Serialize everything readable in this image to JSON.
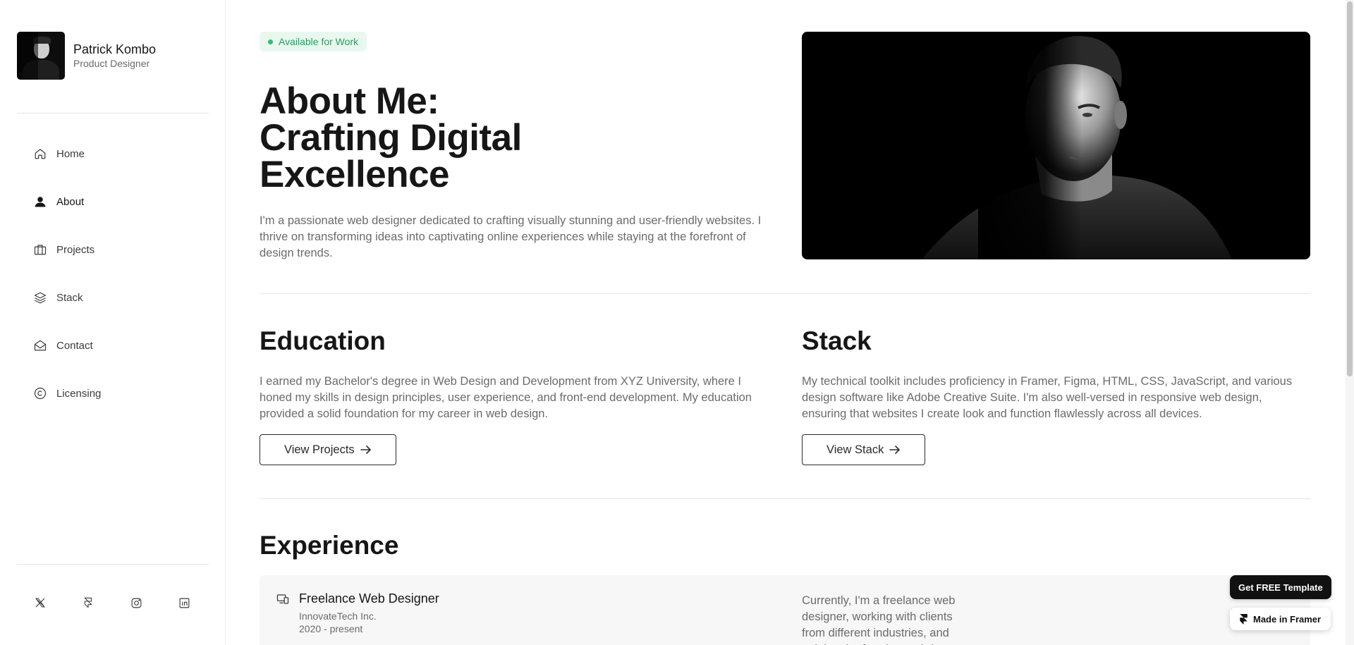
{
  "profile": {
    "name": "Patrick Kombo",
    "role": "Product Designer"
  },
  "nav": {
    "items": [
      {
        "label": "Home",
        "icon": "home-icon"
      },
      {
        "label": "About",
        "icon": "user-icon",
        "active": true
      },
      {
        "label": "Projects",
        "icon": "briefcase-icon"
      },
      {
        "label": "Stack",
        "icon": "layers-icon"
      },
      {
        "label": "Contact",
        "icon": "mail-icon"
      },
      {
        "label": "Licensing",
        "icon": "copyright-icon"
      }
    ]
  },
  "socials": [
    "x-icon",
    "framer-icon",
    "instagram-icon",
    "linkedin-icon"
  ],
  "hero": {
    "badge": "Available for Work",
    "title_lines": [
      "About Me:",
      "Crafting Digital",
      "Excellence"
    ],
    "description": "I'm  a passionate web designer dedicated to crafting visually stunning and user-friendly websites. I thrive on transforming ideas into captivating online experiences while staying at the forefront of design trends."
  },
  "education": {
    "title": "Education",
    "text": "I earned my Bachelor's degree in Web Design and Development from XYZ University, where I honed my skills in design principles, user experience, and front-end development. My education provided a solid foundation for my career in web design.",
    "button": "View Projects"
  },
  "stack": {
    "title": "Stack",
    "text": "My technical toolkit includes proficiency in Framer, Figma, HTML, CSS, JavaScript, and various design software like Adobe Creative Suite. I'm also well-versed in responsive web design, ensuring that websites I create look and function flawlessly across all devices.",
    "button": "View Stack"
  },
  "experience": {
    "title": "Experience",
    "items": [
      {
        "role": "Freelance Web Designer",
        "company": "InnovateTech Inc.",
        "dates": "2020 - present",
        "description": "Currently, I'm a freelance web designer, working with clients from different industries, and gaining the freedom to bring"
      }
    ]
  },
  "framer": {
    "get_template": "Get FREE Template",
    "made_in": "Made in Framer"
  },
  "colors": {
    "accent_green": "#2fbf71",
    "text_dark": "#161616",
    "text_muted": "#6b6b6b",
    "divider": "#e6e6e6"
  }
}
